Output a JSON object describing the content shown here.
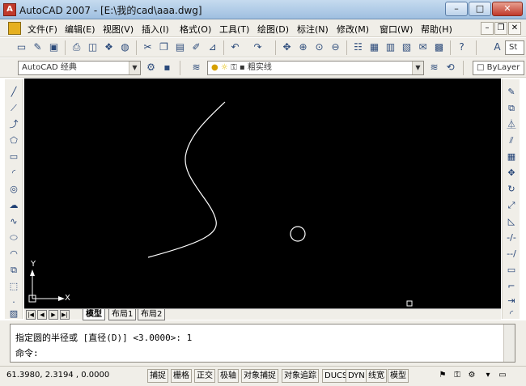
{
  "window": {
    "title": "AutoCAD 2007 - [E:\\我的cad\\aaa.dwg]",
    "app_icon_glyph": "A",
    "min_glyph": "–",
    "max_glyph": "□",
    "close_glyph": "✕"
  },
  "menu": {
    "items": [
      "文件(F)",
      "编辑(E)",
      "视图(V)",
      "插入(I)",
      "格式(O)",
      "工具(T)",
      "绘图(D)",
      "标注(N)",
      "修改(M)",
      "窗口(W)",
      "帮助(H)"
    ],
    "doc_min": "–",
    "doc_restore": "❐",
    "doc_close": "✕"
  },
  "toolbar_styles": {
    "workspace": "AutoCAD 经典",
    "linetype_label": "粗实线",
    "text_style_label": "St",
    "bylayer": "ByLayer"
  },
  "layout_tabs": {
    "tabs": [
      "模型",
      "布局1",
      "布局2"
    ],
    "active": "模型",
    "nav": [
      "|◀",
      "◀",
      "▶",
      "▶|"
    ]
  },
  "ucs": {
    "x_label": "X",
    "y_label": "Y"
  },
  "command": {
    "history": "指定圆的半径或 [直径(D)] <3.0000>: 1",
    "prompt": "命令:"
  },
  "status": {
    "coords": "61.3980, 2.3194 , 0.0000",
    "buttons": [
      "捕捉",
      "栅格",
      "正交",
      "极轴",
      "对象捕捉",
      "对象追踪",
      "DUCS",
      "DYN",
      "线宽",
      "模型"
    ]
  },
  "colors": {
    "canvas_background": "#000000",
    "drawing_stroke": "#ffffff"
  }
}
